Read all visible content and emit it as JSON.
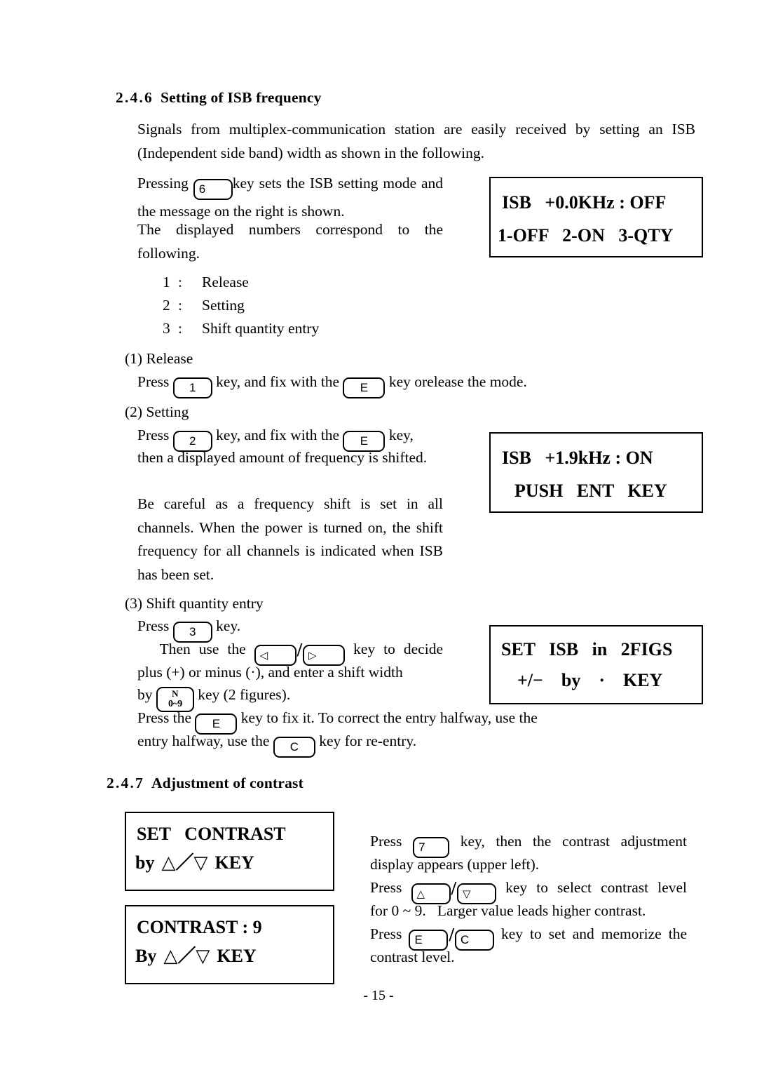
{
  "section_isb": {
    "number": "2.4.6",
    "title": "Setting of ISB frequency",
    "intro": "Signals from multiplex-communication station are easily received by setting an ISB (Independent side band) width as shown in the following.",
    "press_pre": "Pressing",
    "key_6": "6",
    "press_post": "key sets the ISB setting mode and the message on the right is shown.",
    "numbers_note": "The displayed numbers correspond to the following.",
    "list": [
      {
        "num": "1",
        "sep": ":",
        "label": "Release"
      },
      {
        "num": "2",
        "sep": ":",
        "label": "Setting"
      },
      {
        "num": "3",
        "sep": ":",
        "label": "Shift quantity entry"
      }
    ]
  },
  "release": {
    "heading": "(1) Release",
    "press": "Press",
    "key_1": "1",
    "mid": "key, and fix with the",
    "key_e": "E",
    "tail": "key orelease the mode."
  },
  "setting": {
    "heading": "(2) Setting",
    "press": "Press",
    "key_2": "2",
    "mid": "key, and fix with the",
    "key_e": "E",
    "tail": "key,",
    "body1": "then a displayed amount of frequency is shifted.",
    "body2": "Be careful as a frequency shift is set in all channels.   When the power is turned on, the shift frequency for all channels is indicated when ISB has been set."
  },
  "shift_entry": {
    "heading": "(3) Shift quantity entry",
    "press": "Press",
    "key_3": "3",
    "press_tail": "key.",
    "then_use": "Then use the",
    "key_left": "◁",
    "key_right": "▷",
    "decide": "key to decide plus (+) or minus (·), and enter a shift width",
    "by": "by",
    "key_n_top": "N",
    "key_n_bot": "0~9",
    "figures": "key (2 figures).",
    "press_the": "Press the",
    "key_e": "E",
    "fix_it": "key to fix it.   To correct the entry halfway, use the",
    "key_c": "C",
    "reentry": "key for re-entry."
  },
  "lcd_isb_off": {
    "line1": "ISB   +0.0KHz : OFF",
    "line2": "1-OFF   2-ON   3-QTY"
  },
  "lcd_isb_on": {
    "line1": "ISB   +1.9kHz : ON",
    "line2": "PUSH   ENT   KEY"
  },
  "lcd_set_isb": {
    "line1": "SET   ISB   in   2FIGS",
    "line2": "+/−    by    ·    KEY"
  },
  "section_contrast": {
    "number": "2.4.7",
    "title": "Adjustment of contrast"
  },
  "lcd_set_contrast": {
    "line1": "SET   CONTRAST",
    "line2_pre": "by",
    "line2_up": "△",
    "line2_slash": "／",
    "line2_down": "▽",
    "line2_key": "KEY"
  },
  "lcd_contrast_9": {
    "line1": "CONTRAST : 9",
    "line2_pre": "By",
    "line2_up": "△",
    "line2_slash": "／",
    "line2_down": "▽",
    "line2_key": "KEY"
  },
  "contrast_steps": {
    "press1": "Press",
    "key_7": "7",
    "text1": "key, then the contrast adjustment display appears (upper left).",
    "press2": "Press",
    "key_up": "△",
    "key_down": "▽",
    "text2": "key to select contrast level for 0 ~ 9.   Larger value leads higher contrast.",
    "press3": "Press",
    "key_e": "E",
    "key_c": "C",
    "text3": "key to set and memorize the contrast level."
  },
  "footer": {
    "page_number": "- 15 -"
  }
}
